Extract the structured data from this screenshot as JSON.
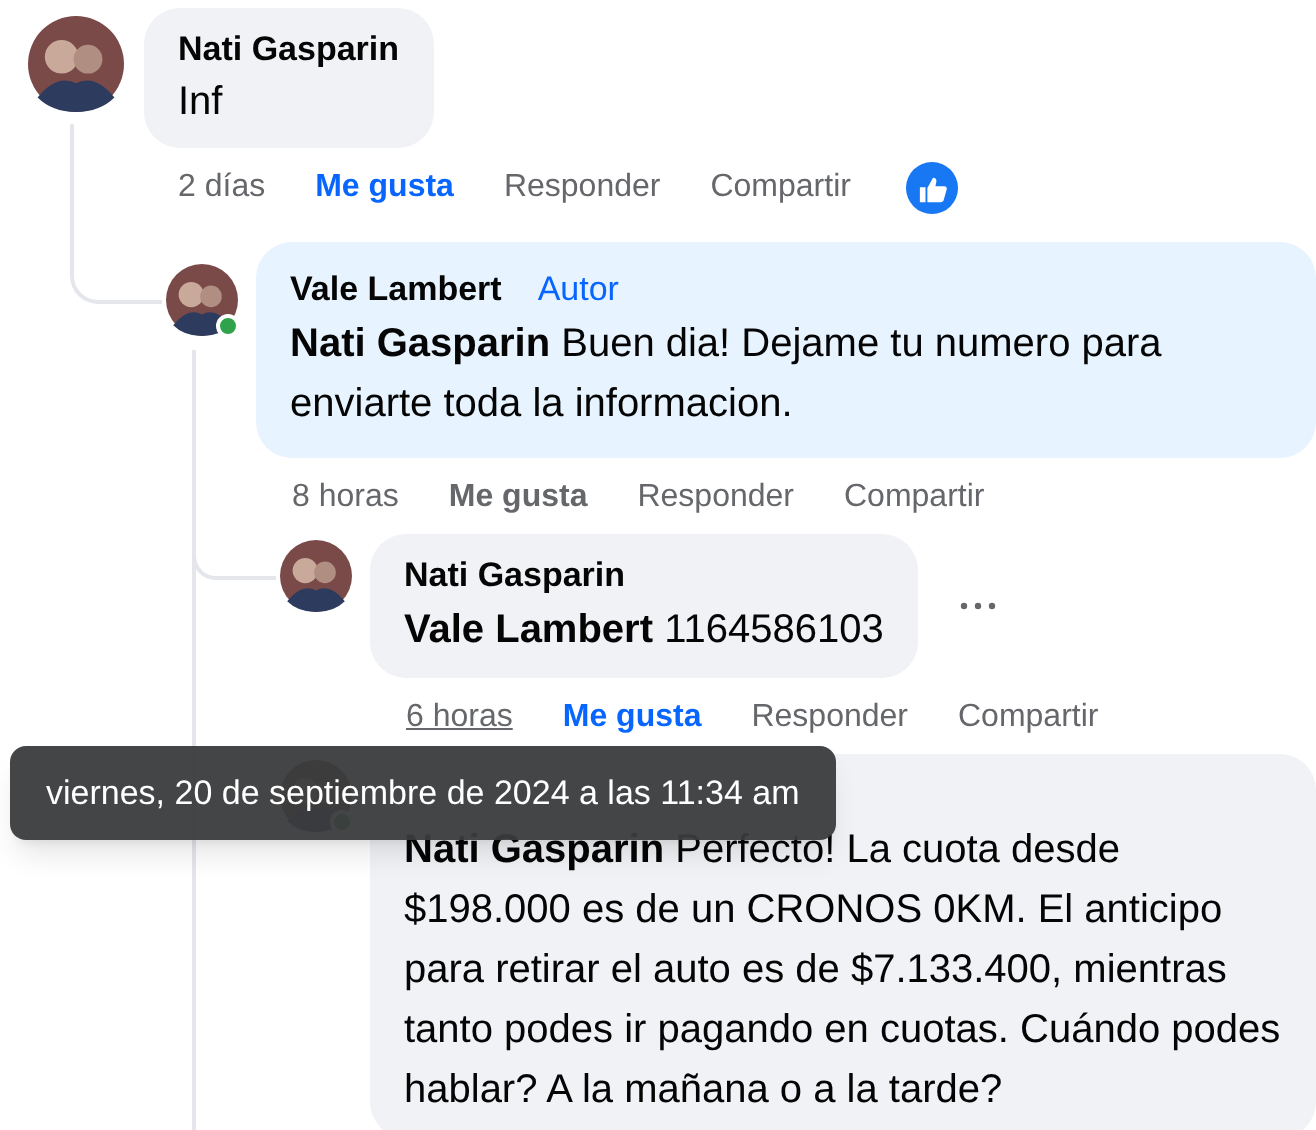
{
  "comments": [
    {
      "author": "Nati Gasparin",
      "text": "Inf",
      "time": "2 días",
      "time_underlined": false,
      "like": "Me gusta",
      "liked": true,
      "reply": "Responder",
      "share": "Compartir",
      "reaction": {
        "kind": "like"
      },
      "children": [
        {
          "author": "Vale Lambert",
          "badge": "Autor",
          "mention": "Nati Gasparin",
          "text": "Buen dia! Dejame tu numero para enviarte toda la informacion.",
          "online": true,
          "highlighted": true,
          "time": "8 horas",
          "time_underlined": false,
          "like": "Me gusta",
          "liked": false,
          "reply": "Responder",
          "share": "Compartir",
          "children": [
            {
              "author": "Nati Gasparin",
              "mention": "Vale Lambert",
              "text": "1164586103",
              "time": "6 horas",
              "time_underlined": true,
              "like": "Me gusta",
              "liked": true,
              "reply": "Responder",
              "share": "Compartir",
              "menu": true
            },
            {
              "mention": "Nati Gasparin",
              "text": "Perfecto! La cuota desde $198.000 es de un CRONOS 0KM. El anticipo para retirar el auto es de $7.133.400, mientras tanto podes ir pagando en cuotas. Cuándo podes hablar? A la mañana o a la tarde?",
              "online": true
            }
          ]
        }
      ]
    }
  ],
  "tooltip": {
    "text": "viernes, 20 de septiembre de 2024 a las 11:34 am"
  }
}
